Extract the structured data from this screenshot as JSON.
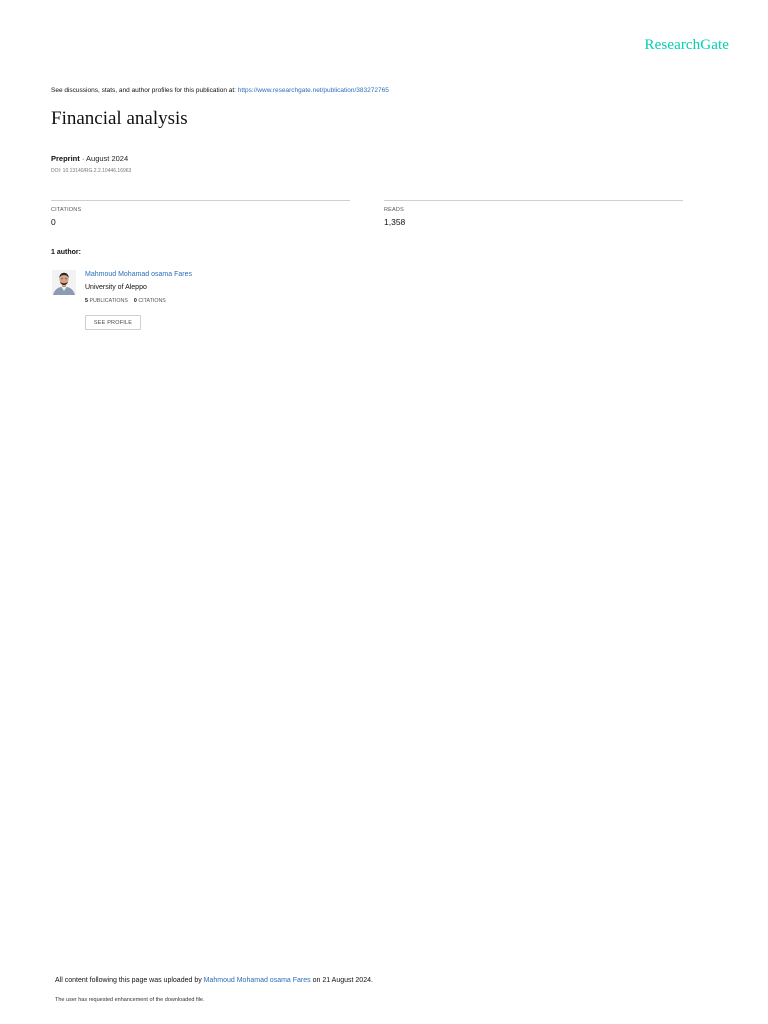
{
  "brand": {
    "name": "ResearchGate",
    "color": "#00d0af"
  },
  "discussions": {
    "prefix": "See discussions, stats, and author profiles for this publication at: ",
    "url": "https://www.researchgate.net/publication/383272765"
  },
  "publication": {
    "title": "Financial analysis",
    "type": "Preprint",
    "date_sep": " · ",
    "date": "August 2024",
    "doi": "DOI: 10.13140/RG.2.2.10446.16963"
  },
  "stats": {
    "citations": {
      "label": "CITATIONS",
      "value": "0"
    },
    "reads": {
      "label": "READS",
      "value": "1,358"
    }
  },
  "authors": {
    "heading": "1 author:",
    "list": [
      {
        "name": "Mahmoud Mohamad osama Fares",
        "institution": "University of Aleppo",
        "publications_count": "5",
        "publications_label": "PUBLICATIONS",
        "citations_count": "0",
        "citations_label": "CITATIONS",
        "profile_button": "SEE PROFILE"
      }
    ]
  },
  "footer": {
    "uploaded_prefix": "All content following this page was uploaded by ",
    "uploader": "Mahmoud Mohamad osama Fares",
    "uploaded_suffix": " on 21 August 2024.",
    "enhancement": "The user has requested enhancement of the downloaded file."
  },
  "colors": {
    "link": "#2a6ebb",
    "rule": "#cfcfcf"
  }
}
